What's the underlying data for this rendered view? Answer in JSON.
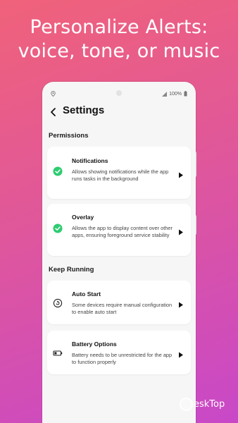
{
  "headline": {
    "line1": "Personalize Alerts:",
    "line2": "voice, tone, or music"
  },
  "status": {
    "battery": "100%"
  },
  "appbar": {
    "title": "Settings"
  },
  "sections": [
    {
      "title": "Permissions"
    },
    {
      "title": "Keep Running"
    }
  ],
  "cards": [
    {
      "icon": "check-circle-icon",
      "title": "Notifications",
      "description": "Allows showing notifications while the app runs tasks in the background"
    },
    {
      "icon": "check-circle-icon",
      "title": "Overlay",
      "description": "Allows the app to display content over other apps, ensuring foreground service stability"
    },
    {
      "icon": "auto-start-icon",
      "title": "Auto Start",
      "description": "Some devices require manual configuration to enable auto start"
    },
    {
      "icon": "battery-icon",
      "title": "Battery Options",
      "description": "Battery needs to be unrestricted for the app to function properly"
    }
  ],
  "watermark": {
    "text": "eskTop"
  },
  "colors": {
    "accent_green": "#2ecc71",
    "background_start": "#f0627a",
    "background_end": "#c848c8"
  }
}
